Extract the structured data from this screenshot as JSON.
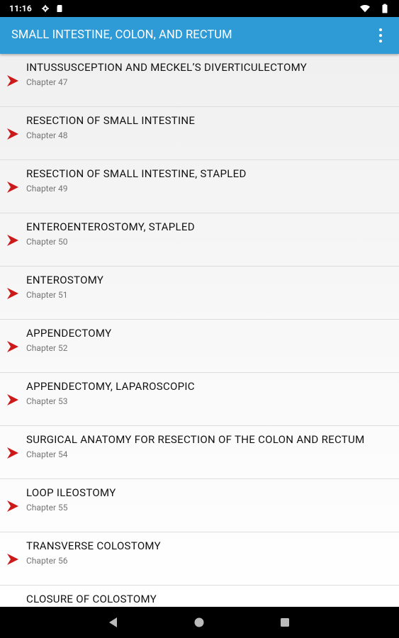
{
  "status_bar": {
    "time": "11:16"
  },
  "app_bar": {
    "title": "SMALL INTESTINE, COLON, AND RECTUM"
  },
  "colors": {
    "app_bar": "#2f9bd6",
    "chevron": "#cc1a1a"
  },
  "chapters": [
    {
      "title": "INTUSSUSCEPTION AND MECKEL’S DIVERTICULECTOMY",
      "chapter": "Chapter 47"
    },
    {
      "title": "RESECTION OF SMALL INTESTINE",
      "chapter": "Chapter 48"
    },
    {
      "title": "RESECTION OF SMALL INTESTINE, STAPLED",
      "chapter": "Chapter 49"
    },
    {
      "title": "ENTEROENTEROSTOMY, STAPLED",
      "chapter": "Chapter 50"
    },
    {
      "title": "ENTEROSTOMY",
      "chapter": "Chapter 51"
    },
    {
      "title": "APPENDECTOMY",
      "chapter": "Chapter 52"
    },
    {
      "title": "APPENDECTOMY, LAPAROSCOPIC",
      "chapter": "Chapter 53"
    },
    {
      "title": "SURGICAL ANATOMY FOR RESECTION OF THE COLON AND RECTUM",
      "chapter": "Chapter 54"
    },
    {
      "title": "LOOP ILEOSTOMY",
      "chapter": "Chapter 55"
    },
    {
      "title": "TRANSVERSE COLOSTOMY",
      "chapter": "Chapter 56"
    },
    {
      "title": "CLOSURE OF COLOSTOMY",
      "chapter": ""
    }
  ],
  "icons": {
    "settings": "gear-icon",
    "sd": "sd-card-icon",
    "wifi": "wifi-icon",
    "battery": "battery-icon",
    "menu": "more-vertical-icon",
    "back": "back-icon",
    "home": "home-icon",
    "recents": "recents-icon",
    "row": "chevron-right-icon"
  }
}
